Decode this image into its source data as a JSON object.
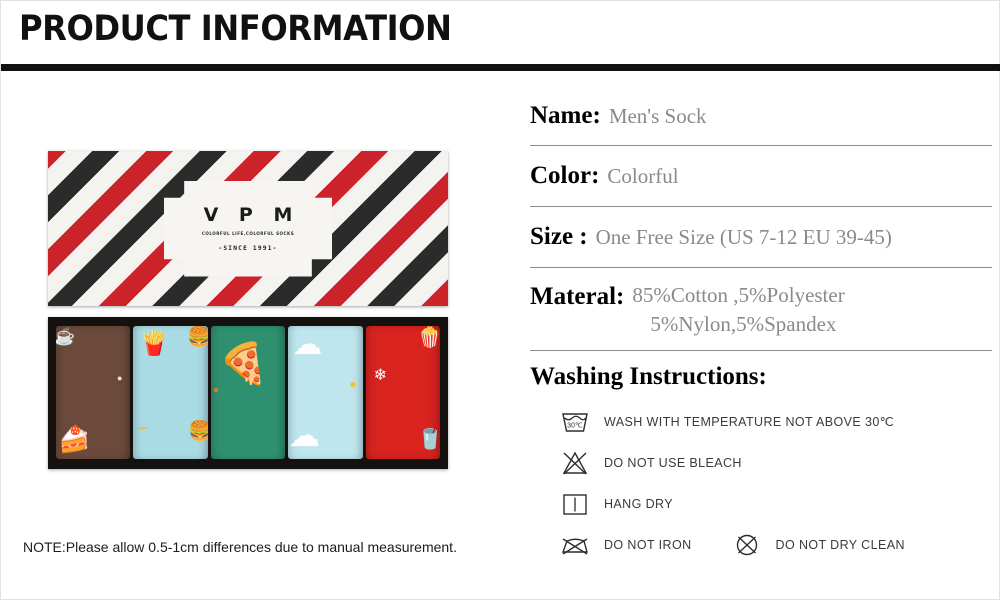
{
  "header": {
    "title": "PRODUCT INFORMATION"
  },
  "product_box": {
    "brand": "V P M",
    "tagline": "COLORFUL LIFE,COLORFUL SOCKS",
    "since": "-SINCE 1991-",
    "lid_colors": {
      "red": "#cc2229",
      "black": "#2b2b2b",
      "white": "#f5f3f0"
    },
    "socks": [
      {
        "name": "coffee-cake-sock",
        "color": "#6b4a3c"
      },
      {
        "name": "fries-burger-sock",
        "color": "#a9dbe4"
      },
      {
        "name": "pizza-sock",
        "color": "#2f9070"
      },
      {
        "name": "egg-cloud-sock",
        "color": "#bfe6ef"
      },
      {
        "name": "popcorn-sock",
        "color": "#d8231f"
      }
    ]
  },
  "specs": [
    {
      "label": "Name:",
      "value": "Men's Sock"
    },
    {
      "label": "Color:",
      "value": "Colorful"
    },
    {
      "label": "Size  :",
      "value": "One Free Size (US 7-12   EU 39-45)"
    }
  ],
  "material": {
    "label": "Materal:",
    "line1": "85%Cotton ,5%Polyester",
    "line2": "5%Nylon,5%Spandex"
  },
  "washing": {
    "title": "Washing Instructions:",
    "items": [
      {
        "icon": "wash-30c-icon",
        "text": "WASH WITH TEMPERATURE NOT ABOVE 30℃",
        "temp": "30℃"
      },
      {
        "icon": "no-bleach-icon",
        "text": "DO NOT USE BLEACH"
      },
      {
        "icon": "hang-dry-icon",
        "text": "HANG DRY"
      },
      {
        "icon": "no-iron-icon",
        "text": "DO NOT IRON"
      },
      {
        "icon": "no-dry-clean-icon",
        "text": "DO NOT DRY CLEAN"
      }
    ]
  },
  "footer": {
    "note": "NOTE:Please allow 0.5-1cm differences due to manual measurement."
  }
}
